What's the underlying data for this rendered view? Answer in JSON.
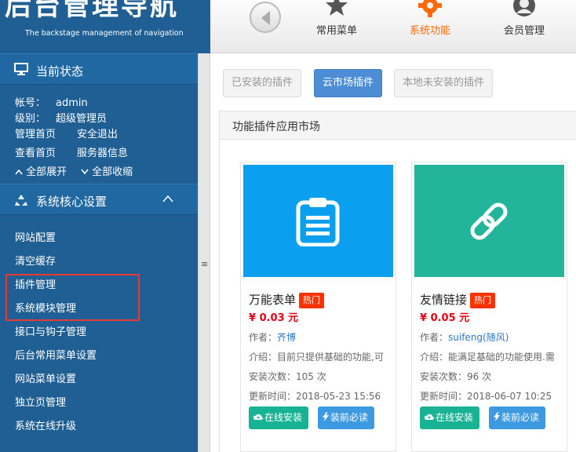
{
  "header": {
    "logo_title": "后台管理导航",
    "logo_subtitle": "The backstage management of navigation",
    "nav": [
      {
        "label": "常用菜单",
        "icon": "star-icon"
      },
      {
        "label": "系统功能",
        "icon": "gear-icon",
        "active": true
      },
      {
        "label": "会员管理",
        "icon": "user-icon"
      }
    ]
  },
  "sidebar": {
    "status_title": "当前状态",
    "account_label": "帐号：",
    "account_value": "admin",
    "level_label": "级别：",
    "level_value": "超级管理员",
    "links": [
      "管理首页",
      "安全退出",
      "查看首页",
      "服务器信息"
    ],
    "expand_all": "全部展开",
    "collapse_all": "全部收缩",
    "section_title": "系统核心设置",
    "menu": [
      "网站配置",
      "清空缓存",
      "插件管理",
      "系统模块管理",
      "接口与钩子管理",
      "后台常用菜单设置",
      "网站菜单设置",
      "独立页管理",
      "系统在线升级"
    ]
  },
  "main": {
    "tabs": [
      {
        "label": "已安装的插件",
        "active": false
      },
      {
        "label": "云市场插件",
        "active": true
      },
      {
        "label": "本地未安装的插件",
        "active": false
      }
    ],
    "panel_title": "功能插件应用市场",
    "cards": [
      {
        "title": "万能表单",
        "badge": "热门",
        "price": "¥ 0.03 元",
        "author_label": "作者：",
        "author": "齐博",
        "intro": "介绍：目前只提供基础的功能,可",
        "installs": "安装次数：105 次",
        "updated": "更新时间：2018-05-23 15:56",
        "icon": "clipboard-icon",
        "color": "#0aa0ef",
        "btn_install": "在线安装",
        "btn_read": "装前必读"
      },
      {
        "title": "友情链接",
        "badge": "热门",
        "price": "¥ 0.05 元",
        "author_label": "作者：",
        "author": "suifeng(随风)",
        "intro": "介绍：能满足基础的功能使用.需",
        "installs": "安装次数：96 次",
        "updated": "更新时间：2018-06-07 10:25",
        "icon": "link-icon",
        "color": "#22b59b",
        "btn_install": "在线安装",
        "btn_read": "装前必读"
      }
    ]
  },
  "colors": {
    "sidebar_bg": "#1f5f93",
    "active_nav": "#ff6a00",
    "active_tab": "#4c8dd6",
    "price": "#e60012",
    "hot_badge": "#ff3300",
    "install_btn": "#18b394",
    "read_btn": "#3d99e0",
    "highlight_box": "#e53935"
  }
}
